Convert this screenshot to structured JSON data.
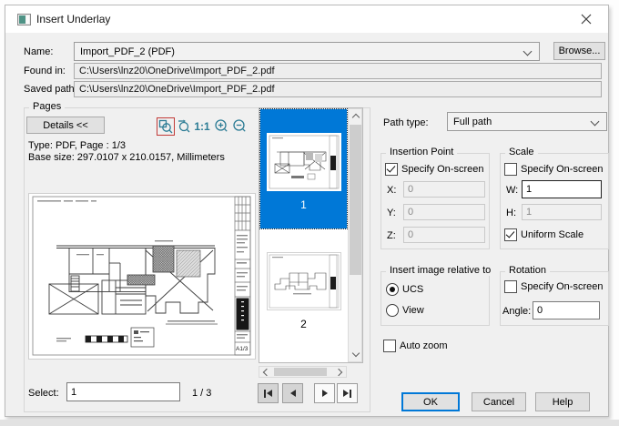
{
  "window": {
    "title": "Insert Underlay"
  },
  "file": {
    "name_label": "Name:",
    "name_value": "Import_PDF_2 (PDF)",
    "browse_label": "Browse...",
    "found_in_label": "Found in:",
    "found_in_value": "C:\\Users\\lnz20\\OneDrive\\Import_PDF_2.pdf",
    "saved_path_label": "Saved path:",
    "saved_path_value": "C:\\Users\\lnz20\\OneDrive\\Import_PDF_2.pdf"
  },
  "pages": {
    "group_label": "Pages",
    "details_button": "Details <<",
    "ratio_icon_label": "1:1",
    "type_line": "Type: PDF, Page : 1/3",
    "base_size_line": "Base size: 297.0107 x 210.0157, Millimeters",
    "thumbnails": [
      {
        "label": "1",
        "selected": true
      },
      {
        "label": "2",
        "selected": false
      }
    ],
    "select_label": "Select:",
    "select_value": "1",
    "page_indicator": "1 / 3",
    "sheet_label": "A1/3"
  },
  "options": {
    "path_type_label": "Path type:",
    "path_type_value": "Full path",
    "insertion_point": {
      "group_label": "Insertion Point",
      "specify_label": "Specify On-screen",
      "specify_checked": true,
      "x_label": "X:",
      "x_value": "0",
      "y_label": "Y:",
      "y_value": "0",
      "z_label": "Z:",
      "z_value": "0"
    },
    "scale": {
      "group_label": "Scale",
      "specify_label": "Specify On-screen",
      "specify_checked": false,
      "w_label": "W:",
      "w_value": "1",
      "h_label": "H:",
      "h_value": "1",
      "uniform_label": "Uniform Scale",
      "uniform_checked": true
    },
    "relative": {
      "group_label": "Insert image relative to",
      "ucs_label": "UCS",
      "view_label": "View",
      "selected": "UCS"
    },
    "rotation": {
      "group_label": "Rotation",
      "specify_label": "Specify On-screen",
      "specify_checked": false,
      "angle_label": "Angle:",
      "angle_value": "0"
    },
    "auto_zoom_label": "Auto zoom"
  },
  "actions": {
    "ok": "OK",
    "cancel": "Cancel",
    "help": "Help"
  },
  "icons": {
    "toolbar": [
      "zoom-window-icon",
      "zoom-dynamic-icon",
      "zoom-ratio-1-1",
      "zoom-in-icon",
      "zoom-out-icon"
    ],
    "nav": [
      "first-page-icon",
      "previous-page-icon",
      "next-page-icon",
      "last-page-icon"
    ]
  },
  "colors": {
    "selection_blue": "#0078d7",
    "icon_teal": "#2c7c95",
    "zoom_active_border": "#c13a38",
    "dialog_bg": "#f0f0f0"
  }
}
